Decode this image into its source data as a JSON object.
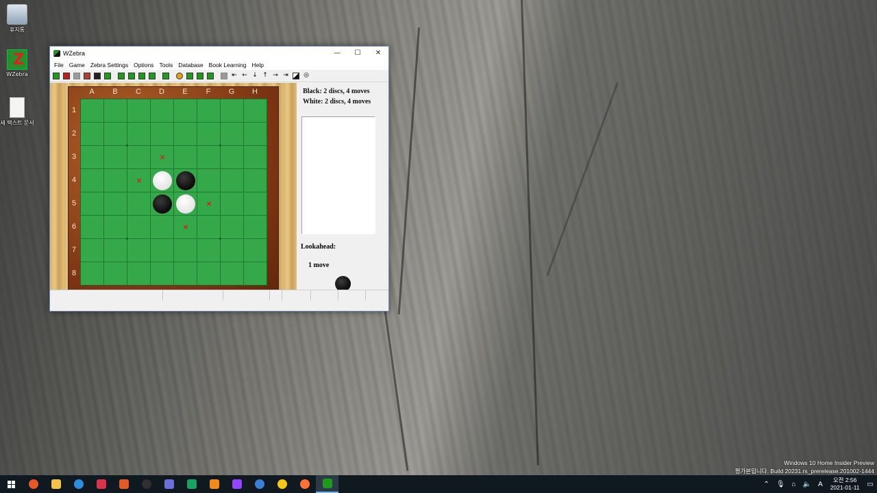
{
  "desktop": {
    "icons": [
      {
        "label": "휴지통",
        "icon": "recycle-bin-icon"
      },
      {
        "label": "WZebra",
        "icon": "wzebra-shortcut-icon"
      },
      {
        "label": "새 텍스트 문서",
        "icon": "text-document-icon"
      }
    ],
    "watermark_line1": "Windows 10 Home Insider Preview",
    "watermark_line2": "평가본입니다. Build 20231.rs_prerelease.201002-1444"
  },
  "window": {
    "title": "WZebra",
    "controls": {
      "minimize": "—",
      "maximize": "☐",
      "close": "✕"
    },
    "menu": [
      "File",
      "Game",
      "Zebra Settings",
      "Options",
      "Tools",
      "Database",
      "Book Learning",
      "Help"
    ],
    "toolbar_icons": [
      "new-game-icon",
      "stop-icon",
      "save-icon",
      "book-icon",
      "black-icon",
      "computer-icon",
      "analyze-icon",
      "cycle-icon",
      "cycle2-icon",
      "replay-icon",
      "think-icon",
      "hint-icon",
      "swap-icon",
      "flip-icon",
      "rotate-icon",
      "board-icon",
      "first-icon",
      "prev-icon",
      "down-icon",
      "up-icon",
      "next-icon",
      "last-icon",
      "diagonal-icon",
      "settings-icon"
    ]
  },
  "board": {
    "columns": [
      "A",
      "B",
      "C",
      "D",
      "E",
      "F",
      "G",
      "H"
    ],
    "rows": [
      "1",
      "2",
      "3",
      "4",
      "5",
      "6",
      "7",
      "8"
    ],
    "discs": [
      {
        "square": "D4",
        "color": "white"
      },
      {
        "square": "E4",
        "color": "black"
      },
      {
        "square": "D5",
        "color": "black"
      },
      {
        "square": "E5",
        "color": "white"
      }
    ],
    "legal_moves": [
      "D3",
      "C4",
      "F5",
      "E6"
    ]
  },
  "status": {
    "black": "Black:  2 discs, 4 moves",
    "white": "White:  2 discs, 4 moves",
    "lookahead_label": "Lookahead:",
    "lookahead_value": "1 move",
    "to_move": "black"
  },
  "taskbar": {
    "apps": [
      {
        "name": "brave-browser-icon",
        "color": "#e8572a"
      },
      {
        "name": "file-explorer-icon",
        "color": "#f3c24a"
      },
      {
        "name": "edge-browser-icon",
        "color": "#2d8ee0"
      },
      {
        "name": "red-app-icon",
        "color": "#d8344c"
      },
      {
        "name": "chrome-like-icon",
        "color": "#e05a2a"
      },
      {
        "name": "obs-icon",
        "color": "#303030"
      },
      {
        "name": "gear-app-icon",
        "color": "#6d6fd8"
      },
      {
        "name": "green-app-icon",
        "color": "#1aa260"
      },
      {
        "name": "vlc-icon",
        "color": "#f08a1c"
      },
      {
        "name": "twitch-icon",
        "color": "#9146ff"
      },
      {
        "name": "qbittorrent-icon",
        "color": "#3c7fd6"
      },
      {
        "name": "media-player-icon",
        "color": "#f5c518"
      },
      {
        "name": "firefox-icon",
        "color": "#ff7139"
      },
      {
        "name": "wzebra-taskbar-icon",
        "color": "#1f9a1f"
      }
    ],
    "clock_time": "오전 2:56",
    "clock_date": "2021-01-11",
    "ime": "A"
  }
}
